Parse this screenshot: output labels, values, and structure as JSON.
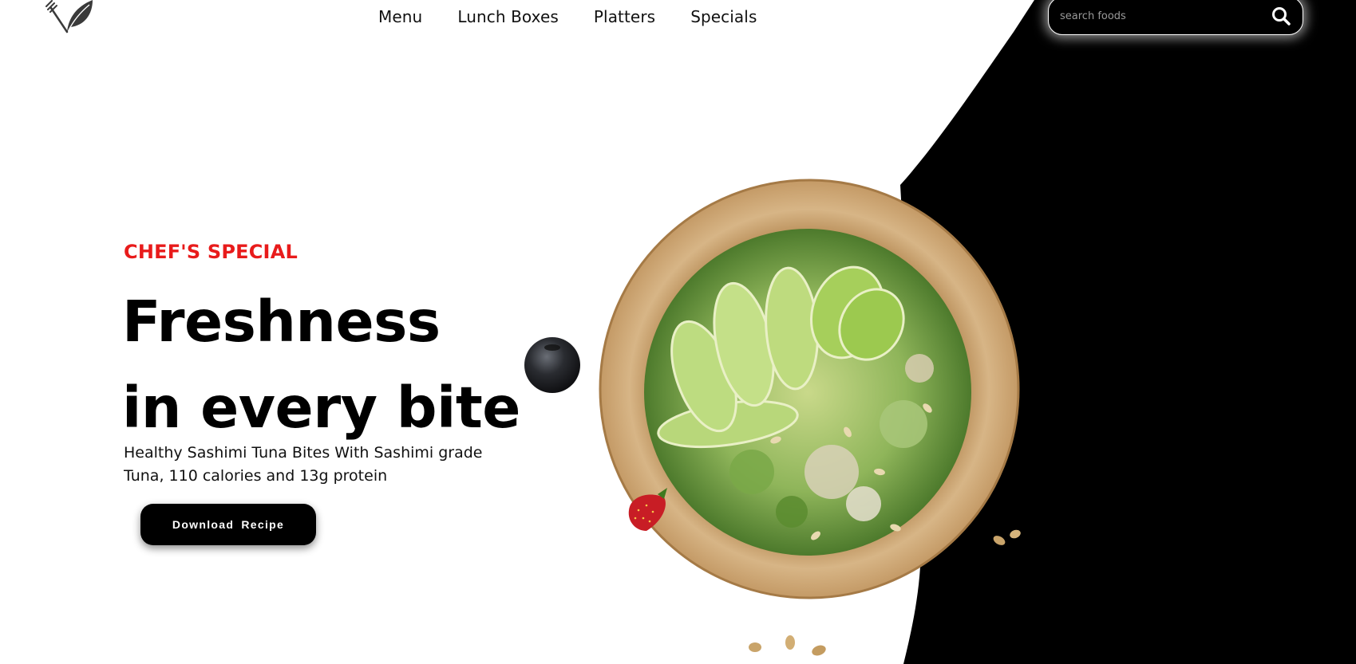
{
  "header": {
    "nav": {
      "menu": "Menu",
      "lunch_boxes": "Lunch Boxes",
      "platters": "Platters",
      "specials": "Specials"
    },
    "search": {
      "placeholder": "search foods",
      "icon": "search-icon"
    },
    "logo_icon": "fork-leaf-logo"
  },
  "hero": {
    "eyebrow": "CHEF'S SPECIAL",
    "headline_line1": "Freshness",
    "headline_line2": "in every bite",
    "description": "Healthy Sashimi Tuna Bites With Sashimi grade Tuna, 110 calories and 13g protein",
    "cta_label": "Download  Recipe"
  },
  "colors": {
    "accent": "#e81b1b",
    "background": "#ffffff",
    "dark_panel": "#000000",
    "button": "#000000"
  }
}
